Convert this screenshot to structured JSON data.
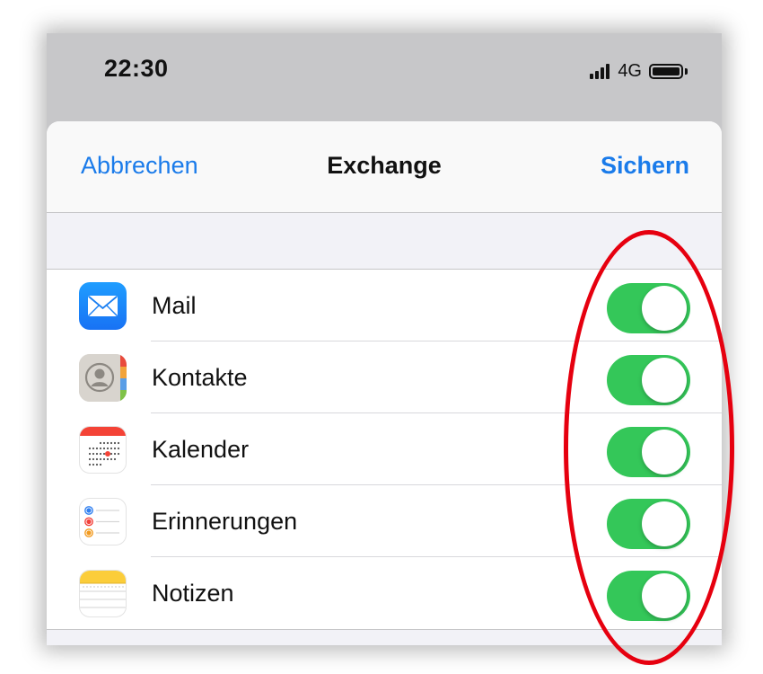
{
  "status_bar": {
    "time": "22:30",
    "network": "4G",
    "signal_icon": "signal-bars-icon",
    "battery_icon": "battery-icon"
  },
  "nav": {
    "cancel_label": "Abbrechen",
    "title": "Exchange",
    "save_label": "Sichern"
  },
  "items": [
    {
      "label": "Mail",
      "icon": "mail-app-icon",
      "enabled": true
    },
    {
      "label": "Kontakte",
      "icon": "contacts-app-icon",
      "enabled": true
    },
    {
      "label": "Kalender",
      "icon": "calendar-app-icon",
      "enabled": true
    },
    {
      "label": "Erinnerungen",
      "icon": "reminders-app-icon",
      "enabled": true
    },
    {
      "label": "Notizen",
      "icon": "notes-app-icon",
      "enabled": true
    }
  ],
  "colors": {
    "accent_blue": "#1a7bea",
    "toggle_on": "#34c759",
    "annotation_red": "#e6000f",
    "status_bar_bg": "#c7c7c9"
  },
  "annotation": {
    "shape": "oval",
    "color": "#e6000f",
    "highlights": "toggles"
  }
}
